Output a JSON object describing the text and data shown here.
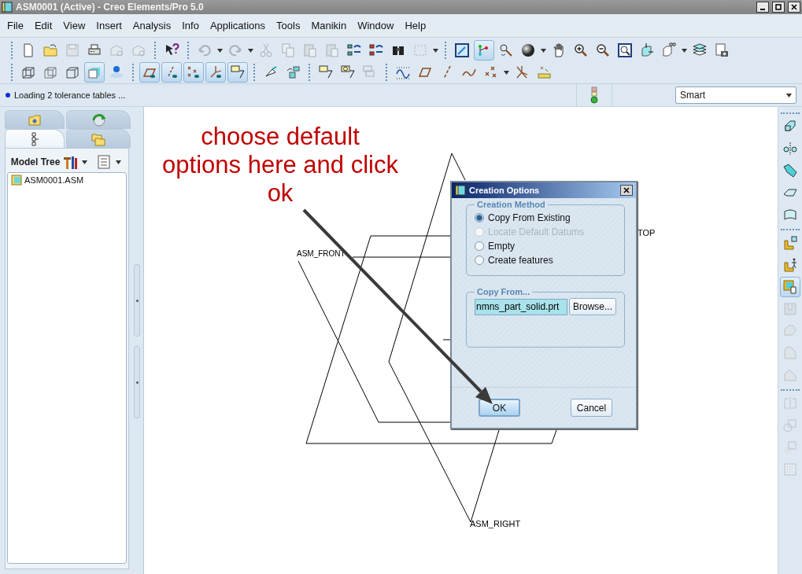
{
  "window": {
    "title": "ASM0001 (Active) - Creo Elements/Pro 5.0"
  },
  "menu": [
    "File",
    "Edit",
    "View",
    "Insert",
    "Analysis",
    "Info",
    "Applications",
    "Tools",
    "Manikin",
    "Window",
    "Help"
  ],
  "toolbar_top": [
    {
      "pressed": false,
      "disabled": false
    },
    {
      "pressed": false,
      "disabled": false
    },
    {
      "pressed": false,
      "disabled": true
    },
    {
      "pressed": false,
      "disabled": false
    },
    {
      "pressed": false,
      "disabled": true
    },
    {
      "pressed": false,
      "disabled": true
    },
    {
      "pressed": false,
      "disabled": false
    },
    {
      "pressed": false,
      "disabled": true
    },
    {
      "pressed": false,
      "disabled": true
    },
    {
      "pressed": false,
      "disabled": true
    },
    {
      "pressed": false,
      "disabled": true
    },
    {
      "pressed": false,
      "disabled": true
    },
    {
      "pressed": false,
      "disabled": true
    },
    {
      "pressed": false,
      "disabled": false
    },
    {
      "pressed": false,
      "disabled": false
    },
    {
      "pressed": false,
      "disabled": false
    },
    {
      "pressed": false,
      "disabled": true
    },
    {
      "pressed": false,
      "disabled": false
    },
    {
      "pressed": true,
      "disabled": false
    },
    {
      "pressed": false,
      "disabled": false
    },
    {
      "pressed": false,
      "disabled": false
    },
    {
      "pressed": false,
      "disabled": false
    },
    {
      "pressed": false,
      "disabled": false
    },
    {
      "pressed": false,
      "disabled": false
    },
    {
      "pressed": false,
      "disabled": false
    },
    {
      "pressed": false,
      "disabled": false
    },
    {
      "pressed": false,
      "disabled": false
    },
    {
      "pressed": false,
      "disabled": false
    },
    {
      "pressed": false,
      "disabled": false
    }
  ],
  "toolbar_bottom": [
    {
      "pressed": false,
      "disabled": false
    },
    {
      "pressed": false,
      "disabled": false
    },
    {
      "pressed": false,
      "disabled": false
    },
    {
      "pressed": true,
      "disabled": false
    },
    {
      "pressed": false,
      "disabled": false
    },
    {
      "pressed": true,
      "disabled": false
    },
    {
      "pressed": true,
      "disabled": false
    },
    {
      "pressed": true,
      "disabled": false
    },
    {
      "pressed": true,
      "disabled": false
    },
    {
      "pressed": true,
      "disabled": false
    },
    {
      "pressed": false,
      "disabled": false
    },
    {
      "pressed": false,
      "disabled": false
    },
    {
      "pressed": false,
      "disabled": false
    },
    {
      "pressed": false,
      "disabled": false
    },
    {
      "pressed": false,
      "disabled": true
    },
    {
      "pressed": false,
      "disabled": false
    },
    {
      "pressed": false,
      "disabled": false
    },
    {
      "pressed": false,
      "disabled": false
    },
    {
      "pressed": false,
      "disabled": false
    },
    {
      "pressed": false,
      "disabled": false
    },
    {
      "pressed": false,
      "disabled": false
    },
    {
      "pressed": false,
      "disabled": false
    }
  ],
  "message": "Loading 2 tolerance tables ...",
  "filter": {
    "value": "Smart"
  },
  "navigator": {
    "tabs": [
      {
        "selected": false
      },
      {
        "selected": false
      },
      {
        "selected": true
      },
      {
        "selected": false
      }
    ],
    "title": "Model Tree",
    "tree": [
      {
        "label": "ASM0001.ASM"
      }
    ]
  },
  "right_toolbar": [
    {
      "pressed": false,
      "disabled": false
    },
    {
      "pressed": false,
      "disabled": false
    },
    {
      "pressed": false,
      "disabled": false
    },
    {
      "pressed": false,
      "disabled": false
    },
    {
      "pressed": false,
      "disabled": false
    },
    {
      "pressed": false,
      "disabled": false
    },
    {
      "pressed": false,
      "disabled": false
    },
    {
      "pressed": true,
      "disabled": false
    },
    {
      "pressed": false,
      "disabled": true
    },
    {
      "pressed": false,
      "disabled": true
    },
    {
      "pressed": false,
      "disabled": true
    },
    {
      "pressed": false,
      "disabled": true
    },
    {
      "pressed": false,
      "disabled": true
    },
    {
      "pressed": false,
      "disabled": true
    },
    {
      "pressed": false,
      "disabled": true
    },
    {
      "pressed": false,
      "disabled": true
    }
  ],
  "datums": [
    {
      "label": "ASM_FRONT"
    },
    {
      "label": "TOP"
    },
    {
      "label": "ASM_RIGHT"
    }
  ],
  "annotation": {
    "lines": [
      "choose default",
      "options here and click",
      "ok"
    ]
  },
  "dialog": {
    "title": "Creation Options",
    "method_group": "Creation Method",
    "methods": [
      {
        "label": "Copy From Existing",
        "selected": true,
        "disabled": false
      },
      {
        "label": "Locate Default Datums",
        "selected": false,
        "disabled": true
      },
      {
        "label": "Empty",
        "selected": false,
        "disabled": false
      },
      {
        "label": "Create features",
        "selected": false,
        "disabled": false
      }
    ],
    "copy_group": "Copy From...",
    "copy_value": "nmns_part_solid.prt",
    "browse": "Browse...",
    "buttons": [
      {
        "label": "OK",
        "default": true
      },
      {
        "label": "Cancel",
        "default": false
      }
    ]
  }
}
